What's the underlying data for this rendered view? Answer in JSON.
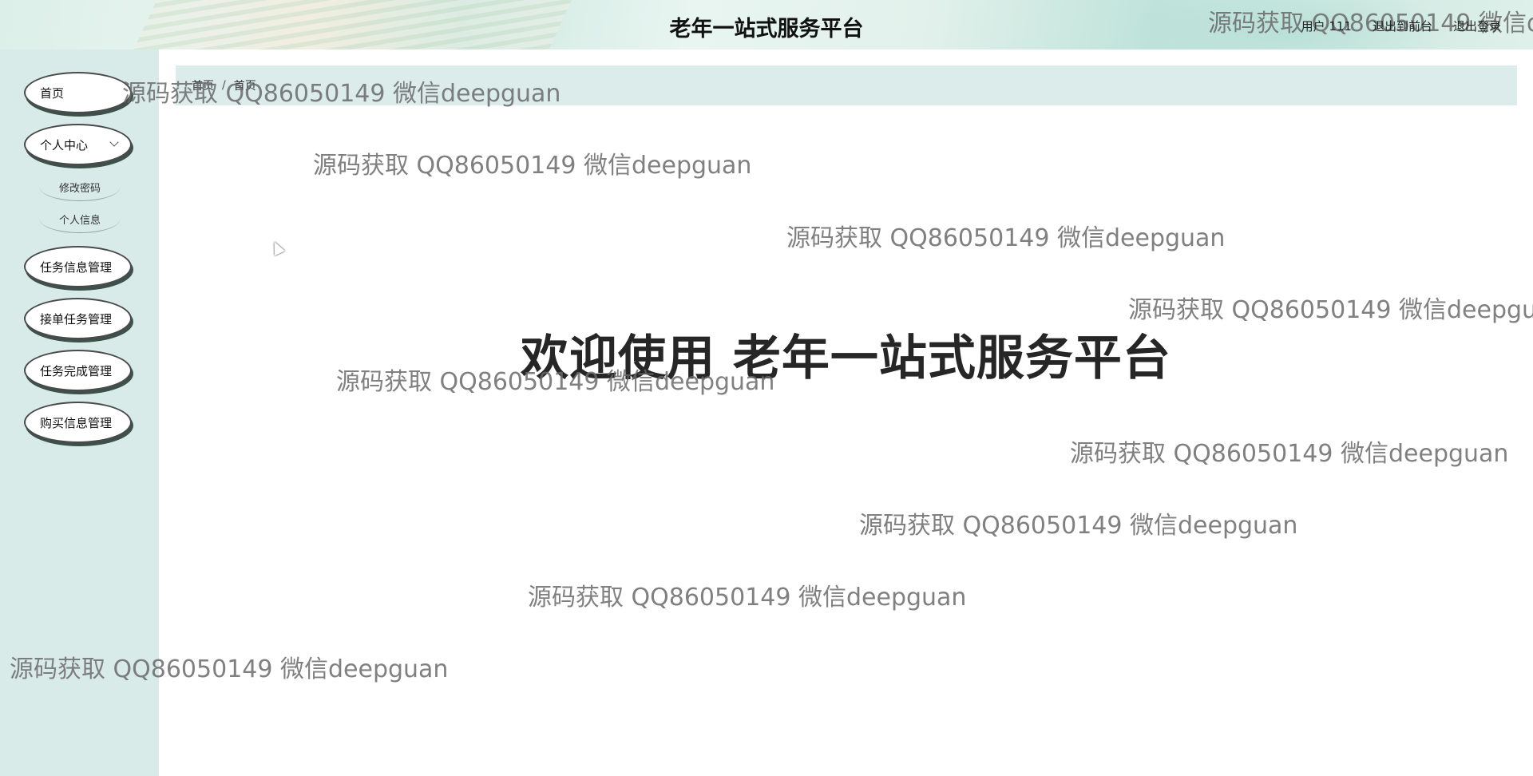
{
  "header": {
    "title": "老年一站式服务平台",
    "user_label": "用户 111",
    "back_to_front": "退出到前台",
    "logout": "退出登录"
  },
  "sidebar": {
    "items": [
      {
        "label": "首页"
      },
      {
        "label": "个人中心",
        "expanded": true,
        "children": [
          {
            "label": "修改密码"
          },
          {
            "label": "个人信息"
          }
        ]
      },
      {
        "label": "任务信息管理"
      },
      {
        "label": "接单任务管理"
      },
      {
        "label": "任务完成管理"
      },
      {
        "label": "购买信息管理"
      }
    ]
  },
  "breadcrumb": {
    "home_label": "首页",
    "separator": "/",
    "current": "首页"
  },
  "main": {
    "welcome": "欢迎使用 老年一站式服务平台"
  },
  "watermark": {
    "text": "源码获取 QQ86050149 微信deepguan"
  },
  "colors": {
    "sidebar_bg": "#d9ebe9",
    "breadcrumb_bg": "#dbecea",
    "menu_border": "#4a4a4a"
  }
}
